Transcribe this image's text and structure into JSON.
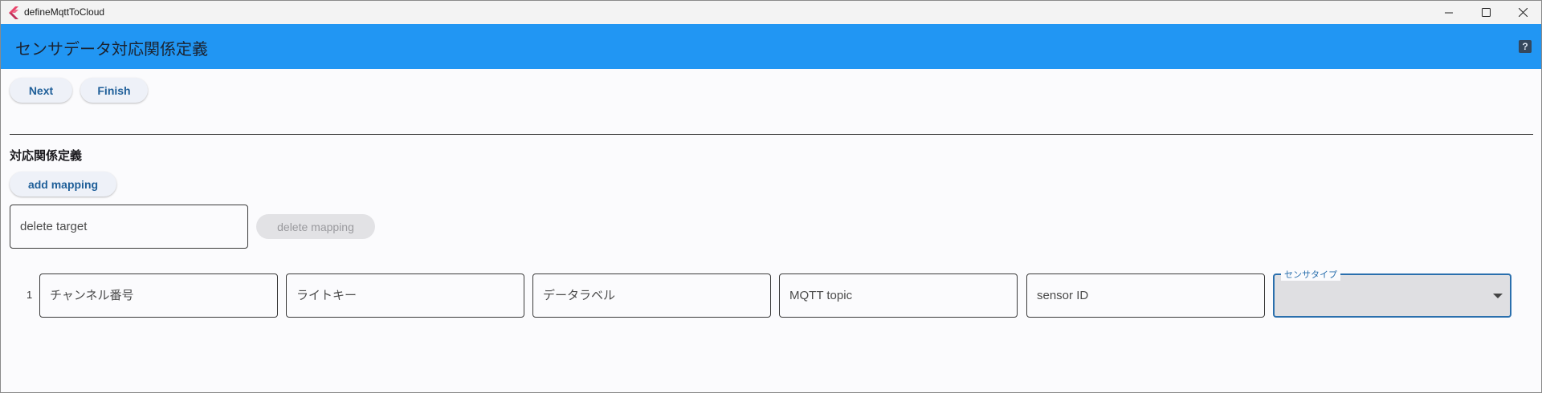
{
  "window": {
    "title": "defineMqttToCloud"
  },
  "appbar": {
    "title": "センサデータ対応関係定義",
    "help_icon": "help-icon"
  },
  "toolbar": {
    "next_label": "Next",
    "finish_label": "Finish"
  },
  "mapping_section": {
    "title": "対応関係定義",
    "add_label": "add mapping",
    "delete_target_placeholder": "delete target",
    "delete_target_value": "",
    "delete_label": "delete mapping"
  },
  "mapping_rows": [
    {
      "index": "1",
      "channel_placeholder": "チャンネル番号",
      "write_key_placeholder": "ライトキー",
      "data_label_placeholder": "データラベル",
      "mqtt_topic_placeholder": "MQTT topic",
      "sensor_id_placeholder": "sensor ID",
      "sensor_type_label": "センサタイプ",
      "sensor_type_value": ""
    }
  ],
  "colors": {
    "appbar": "#2196f3",
    "accent": "#2a6fad",
    "button_text": "#1f5f99"
  }
}
